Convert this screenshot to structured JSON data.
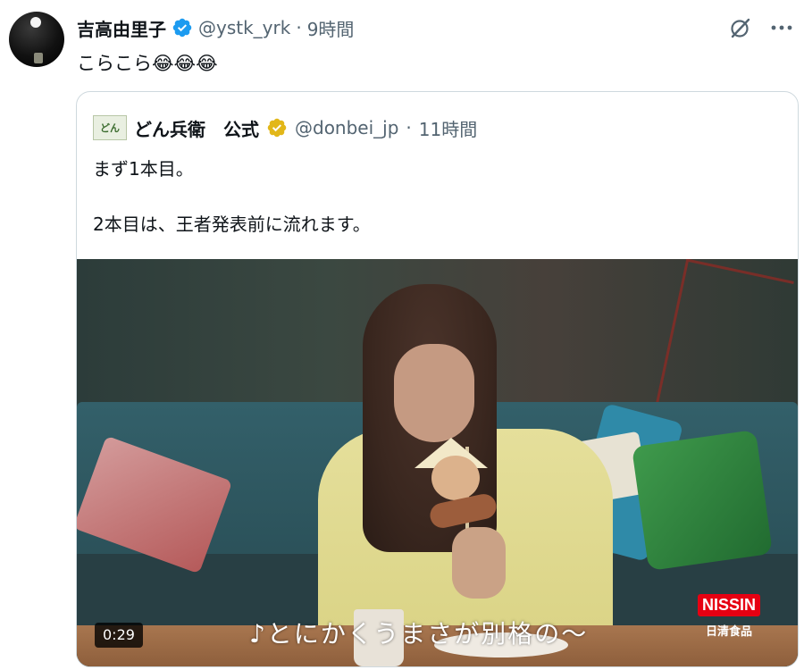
{
  "post": {
    "author_name": "吉高由里子",
    "handle": "@ystk_yrk",
    "separator": "·",
    "time": "9時間",
    "text": "こらこら😂😂😂"
  },
  "quote": {
    "logo_text": "どん",
    "author_name": "どん兵衛　公式",
    "handle": "@donbei_jp",
    "separator": "·",
    "time": "11時間",
    "line1": "まず1本目。",
    "line2": "2本目は、王者発表前に流れます。",
    "video": {
      "duration": "0:29",
      "caption": "♪とにかくうまさが別格の〜",
      "brand_name": "NISSIN",
      "brand_sub": "日清食品"
    }
  },
  "icons": {
    "verified_blue": "verified-badge-blue",
    "verified_gold": "verified-badge-gold",
    "grok": "grok-icon",
    "more": "more-icon"
  },
  "colors": {
    "verified_blue": "#1d9bf0",
    "verified_gold": "#e2b719",
    "secondary_text": "#536471",
    "border": "#cfd9de",
    "brand_red": "#e60012"
  }
}
